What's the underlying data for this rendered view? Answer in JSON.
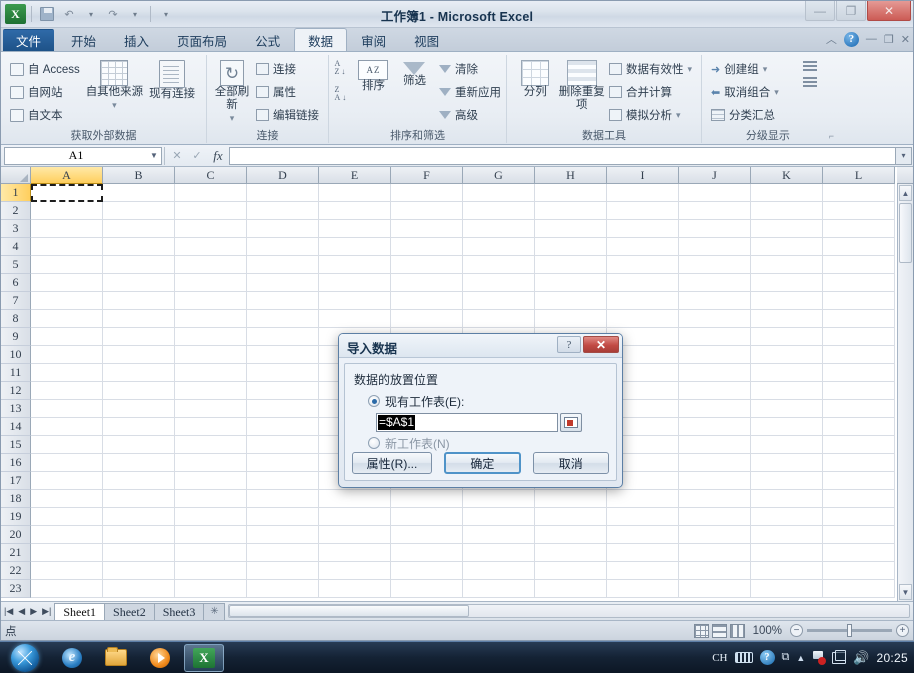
{
  "window": {
    "title": "工作簿1 - Microsoft Excel",
    "qat": {
      "excel_icon": "excel-icon",
      "save_label": "保存",
      "undo_label": "撤销",
      "redo_label": "恢复",
      "customize_label": "自定义快速访问工具栏"
    },
    "controls": {
      "minimize": "—",
      "maximize": "❐",
      "close": "✕"
    }
  },
  "tabs": {
    "file": "文件",
    "items": [
      "开始",
      "插入",
      "页面布局",
      "公式",
      "数据",
      "审阅",
      "视图"
    ],
    "active": "数据",
    "right_controls": {
      "collapse_ribbon": "︿",
      "help": "?",
      "minimize": "—",
      "restore": "❐",
      "close": "✕"
    }
  },
  "ribbon": {
    "groups": [
      {
        "label": "获取外部数据",
        "small_buttons": [
          "自 Access",
          "自网站",
          "自文本"
        ],
        "big_buttons": [
          "自其他来源",
          "现有连接"
        ]
      },
      {
        "label": "连接",
        "big_buttons": [
          "全部刷新"
        ],
        "small_buttons": [
          "连接",
          "属性",
          "编辑链接"
        ]
      },
      {
        "label": "排序和筛选",
        "big_buttons": [
          "排序",
          "筛选"
        ],
        "small_buttons": [
          "清除",
          "重新应用",
          "高级"
        ],
        "sort_asc": "升序排序",
        "sort_desc": "降序排序"
      },
      {
        "label": "数据工具",
        "big_buttons": [
          "分列",
          "删除重复项"
        ],
        "small_buttons": [
          "数据有效性",
          "合并计算",
          "模拟分析"
        ]
      },
      {
        "label": "分级显示",
        "small_buttons": [
          "创建组",
          "取消组合",
          "分类汇总"
        ],
        "extra": [
          "显示明细数据",
          "隐藏明细数据"
        ],
        "dialog_launcher": "⌐"
      }
    ]
  },
  "formula_bar": {
    "name_box": "A1",
    "name_box_caret": "▼",
    "cancel": "✕",
    "enter": "✓",
    "fx": "fx",
    "value": "",
    "expand": "▾"
  },
  "grid": {
    "columns": [
      "A",
      "B",
      "C",
      "D",
      "E",
      "F",
      "G",
      "H",
      "I",
      "J",
      "K",
      "L"
    ],
    "rows": [
      1,
      2,
      3,
      4,
      5,
      6,
      7,
      8,
      9,
      10,
      11,
      12,
      13,
      14,
      15,
      16,
      17,
      18,
      19,
      20,
      21,
      22,
      23
    ],
    "selected_column": "A",
    "selected_row": 1,
    "active_cell": "A1",
    "cell_has_marching_ants": true
  },
  "sheet_tabs": {
    "nav": [
      "|◀",
      "◀",
      "▶",
      "▶|"
    ],
    "items": [
      "Sheet1",
      "Sheet2",
      "Sheet3"
    ],
    "active": "Sheet1",
    "insert_label": "插入工作表"
  },
  "status_bar": {
    "mode": "点",
    "views": [
      "普通视图",
      "页面布局视图",
      "分页预览"
    ],
    "zoom": "100%",
    "zoom_out": "−",
    "zoom_in": "+"
  },
  "dialog": {
    "title": "导入数据",
    "help_button": "?",
    "close_button": "✕",
    "legend": "数据的放置位置",
    "option_existing": "现有工作表(E):",
    "option_existing_selected": true,
    "reference_value": "=$A$1",
    "reference_picker": "collapse-dialog-icon",
    "option_new": "新工作表(N)",
    "option_new_selected": false,
    "buttons": {
      "properties": "属性(R)...",
      "ok": "确定",
      "cancel": "取消"
    }
  },
  "taskbar": {
    "start": "start-orb-icon",
    "items": [
      "internet-explorer-icon",
      "file-explorer-icon",
      "media-player-icon",
      "excel-icon"
    ],
    "active_item": "excel-icon",
    "tray": {
      "input_method": "CH",
      "keyboard": "keyboard-icon",
      "help": "?",
      "show_hidden": "▲",
      "security": "security-alert-icon",
      "network": "network-icon",
      "volume": "🔊",
      "clock": "20:25"
    }
  },
  "colors": {
    "accent_blue": "#2b6aa8",
    "selection_gold": "#ffcf5e",
    "close_red": "#c24b45",
    "excel_green": "#1d7333"
  }
}
